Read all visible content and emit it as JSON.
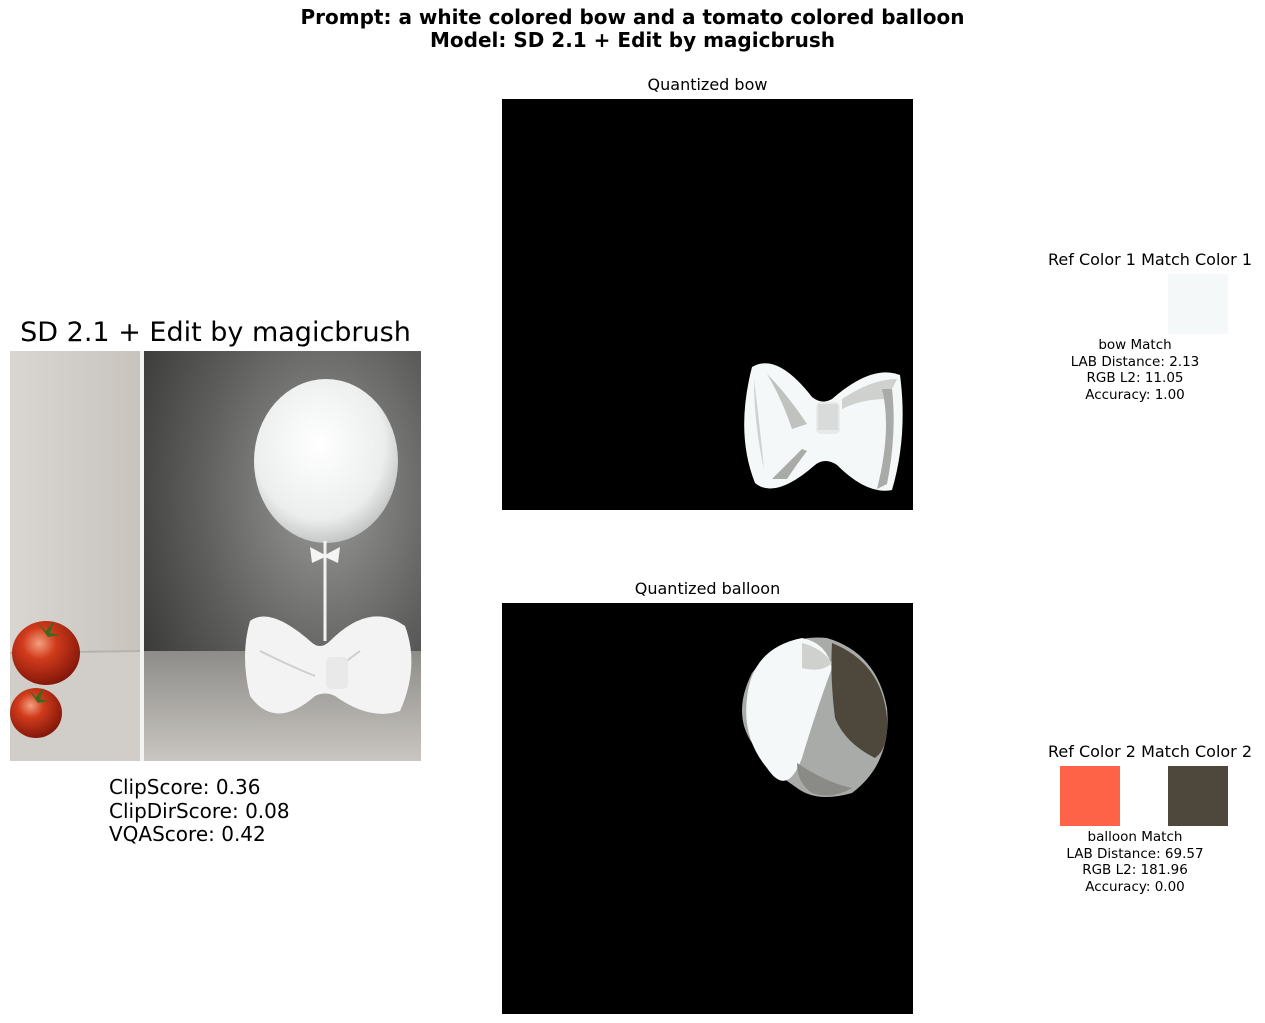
{
  "header": {
    "prompt_line": "Prompt: a white colored bow and a tomato colored balloon",
    "model_line": "Model: SD 2.1 + Edit by magicbrush"
  },
  "left_panel": {
    "title": "SD 2.1 + Edit by magicbrush",
    "scores": [
      "ClipScore: 0.36",
      "ClipDirScore: 0.08",
      "VQAScore: 0.42"
    ]
  },
  "quantized": [
    {
      "title": "Quantized bow"
    },
    {
      "title": "Quantized balloon"
    }
  ],
  "matches": [
    {
      "header": "Ref Color 1 Match Color 1",
      "ref_color": "#ffffff",
      "match_color": "#f4f8f8",
      "lines": [
        "bow Match",
        "LAB Distance: 2.13",
        "RGB L2: 11.05",
        "Accuracy: 1.00"
      ]
    },
    {
      "header": "Ref Color 2 Match Color 2",
      "ref_color": "#ff6347",
      "match_color": "#4d473c",
      "lines": [
        "balloon Match",
        "LAB Distance: 69.57",
        "RGB L2: 181.96",
        "Accuracy: 0.00"
      ]
    }
  ],
  "colors": {
    "image_background": "#000000",
    "bow_white": "#f5f8f8",
    "shade_light": "#cfd1cf",
    "shade_mid": "#a9aba8",
    "shade_dark": "#4d473c"
  }
}
